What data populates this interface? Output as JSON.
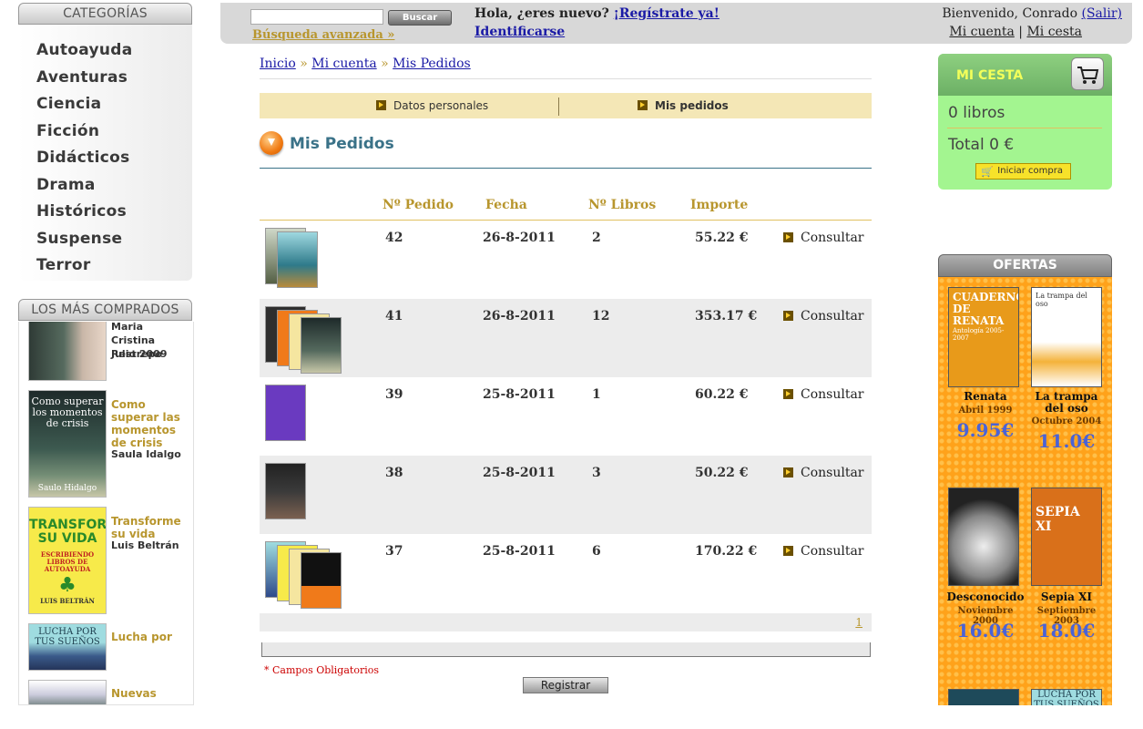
{
  "sidebar": {
    "categories_title": "CATEGORÍAS",
    "categories": [
      "Autoayuda",
      "Aventuras",
      "Ciencia",
      "Ficción",
      "Didácticos",
      "Drama",
      "Históricos",
      "Suspense",
      "Terror"
    ],
    "best_title": "LOS MÁS COMPRADOS",
    "best": [
      {
        "title": "",
        "author": "Maria Cristina Restrepo",
        "date": "Julio 2009"
      },
      {
        "title": "Como superar las momentos de crisis",
        "author": "Saula Idalgo",
        "cover_text": "Como superar los momentos de crisis",
        "cover_author": "Saulo Hidalgo"
      },
      {
        "title": "Transforme su vida",
        "author": "Luis Beltrán",
        "cover_text": "TRANSFORME SU VIDA",
        "cover_sub": "ESCRIBIENDO LIBROS DE AUTOAYUDA",
        "cover_author": "LUIS BELTRÁN"
      },
      {
        "title": "Lucha por",
        "author": "",
        "cover_text": "LUCHA POR TUS SUEÑOS"
      },
      {
        "title": "Nuevas",
        "author": ""
      }
    ]
  },
  "topbar": {
    "search_placeholder": "",
    "search_button": "Buscar",
    "advanced_search": "Búsqueda avanzada »",
    "hello": "Hola, ¿eres nuevo?",
    "register_link": "¡Regístrate ya!",
    "login_link": "Identificarse",
    "welcome": "Bienvenido, Conrado",
    "logout": "(Salir)",
    "my_account": "Mi cuenta",
    "sep": "|",
    "my_cart": "Mi cesta"
  },
  "breadcrumb": {
    "items": [
      "Inicio",
      "Mi cuenta",
      "Mis Pedidos"
    ],
    "sep": "»"
  },
  "tabs": [
    "Datos personales",
    "Mis pedidos"
  ],
  "section_title": "Mis Pedidos",
  "table": {
    "headers": [
      "Nº Pedido",
      "Fecha",
      "Nº Libros",
      "Importe"
    ],
    "action": "Consultar",
    "rows": [
      {
        "id": "42",
        "date": "26-8-2011",
        "books": "2",
        "amount": "55.22 €"
      },
      {
        "id": "41",
        "date": "26-8-2011",
        "books": "12",
        "amount": "353.17 €"
      },
      {
        "id": "39",
        "date": "25-8-2011",
        "books": "1",
        "amount": "60.22 €"
      },
      {
        "id": "38",
        "date": "25-8-2011",
        "books": "3",
        "amount": "50.22 €"
      },
      {
        "id": "37",
        "date": "25-8-2011",
        "books": "6",
        "amount": "170.22 €"
      }
    ],
    "page": "1"
  },
  "required_note": "* Campos Obligatorios",
  "register_button": "Registrar",
  "cart": {
    "title": "MI CESTA",
    "books": "0 libros",
    "total": "Total 0 €",
    "button": "Iniciar compra"
  },
  "offers": {
    "title": "OFERTAS",
    "items": [
      {
        "title": "Renata",
        "date": "Abril 1999",
        "price": "9.95€",
        "cover_text": "CUADERNOS DE RENATA",
        "cover_sub": "Antología 2005-2007"
      },
      {
        "title": "La trampa del oso",
        "date": "Octubre 2004",
        "price": "11.0€",
        "cover_text": "La trampa del oso"
      },
      {
        "title": "Desconocido",
        "date": "Noviembre 2000",
        "price": "16.0€"
      },
      {
        "title": "Sepia XI",
        "date": "Septiembre 2003",
        "price": "18.0€",
        "cover_text": "SEPIA XI"
      }
    ]
  },
  "colors": {
    "accent": "#b8962e",
    "title": "#3a7288",
    "cart_bg": "#a3f590",
    "offers_bg": "#ffa21a",
    "tabs_bg": "#f4e7b6"
  }
}
